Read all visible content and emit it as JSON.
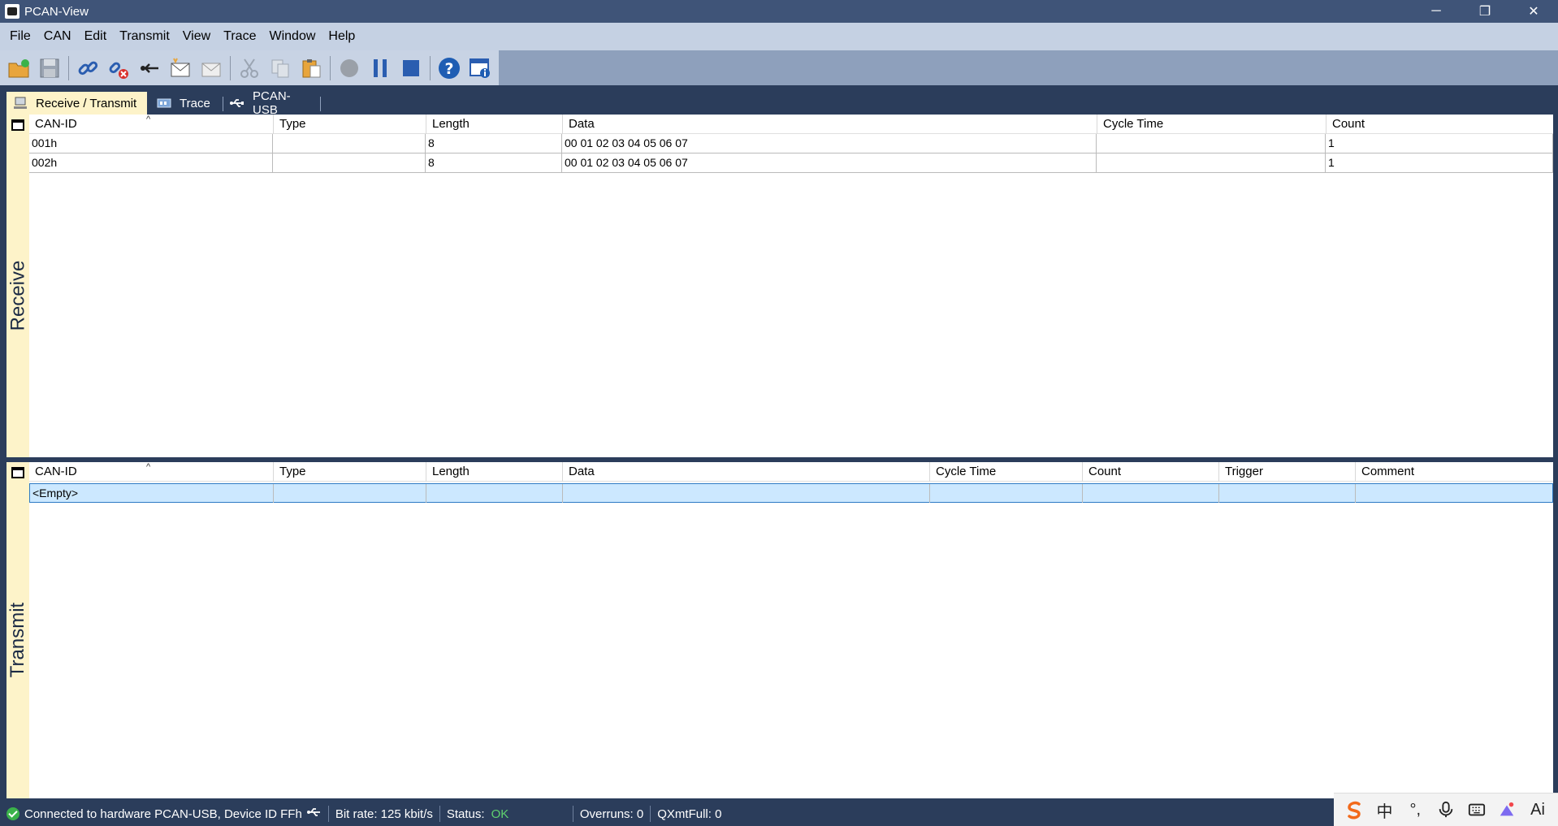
{
  "window": {
    "title": "PCAN-View",
    "controls": [
      "─",
      "❐",
      "✕"
    ]
  },
  "menu": [
    "File",
    "CAN",
    "Edit",
    "Transmit",
    "View",
    "Trace",
    "Window",
    "Help"
  ],
  "toolbar": {
    "buttons": [
      "open-icon",
      "save-icon",
      "connect-icon",
      "disconnect-icon",
      "reset-icon",
      "new-message-icon",
      "edit-message-icon",
      "cut-icon",
      "copy-icon",
      "paste-icon",
      "record-icon",
      "pause-icon",
      "stop-icon",
      "help-icon",
      "info-icon"
    ]
  },
  "tabs": [
    {
      "label": "Receive / Transmit",
      "active": true
    },
    {
      "label": "Trace",
      "active": false
    },
    {
      "label": "PCAN-USB",
      "active": false
    }
  ],
  "receive": {
    "side_label": "Receive",
    "columns": [
      "CAN-ID",
      "Type",
      "Length",
      "Data",
      "Cycle Time",
      "Count"
    ],
    "rows": [
      {
        "can_id": "001h",
        "type": "",
        "length": "8",
        "data": "00 01 02 03 04 05 06 07",
        "cycle_time": "",
        "count": "1"
      },
      {
        "can_id": "002h",
        "type": "",
        "length": "8",
        "data": "00 01 02 03 04 05 06 07",
        "cycle_time": "",
        "count": "1"
      }
    ]
  },
  "transmit": {
    "side_label": "Transmit",
    "columns": [
      "CAN-ID",
      "Type",
      "Length",
      "Data",
      "Cycle Time",
      "Count",
      "Trigger",
      "Comment"
    ],
    "rows": [
      {
        "can_id": "<Empty>"
      }
    ]
  },
  "status": {
    "connection": "Connected to hardware PCAN-USB, Device ID FFh",
    "bit_rate": "Bit rate: 125 kbit/s",
    "status_label": "Status:",
    "status_value": "OK",
    "overruns": "Overruns: 0",
    "qxmtfull": "QXmtFull: 0"
  },
  "ime": {
    "lang": "中",
    "ai": "Ai"
  },
  "colors": {
    "accent": "#2b3d5b",
    "tab_active": "#fdf3c9",
    "ok": "#5fd16f",
    "selection": "#cce8ff"
  }
}
